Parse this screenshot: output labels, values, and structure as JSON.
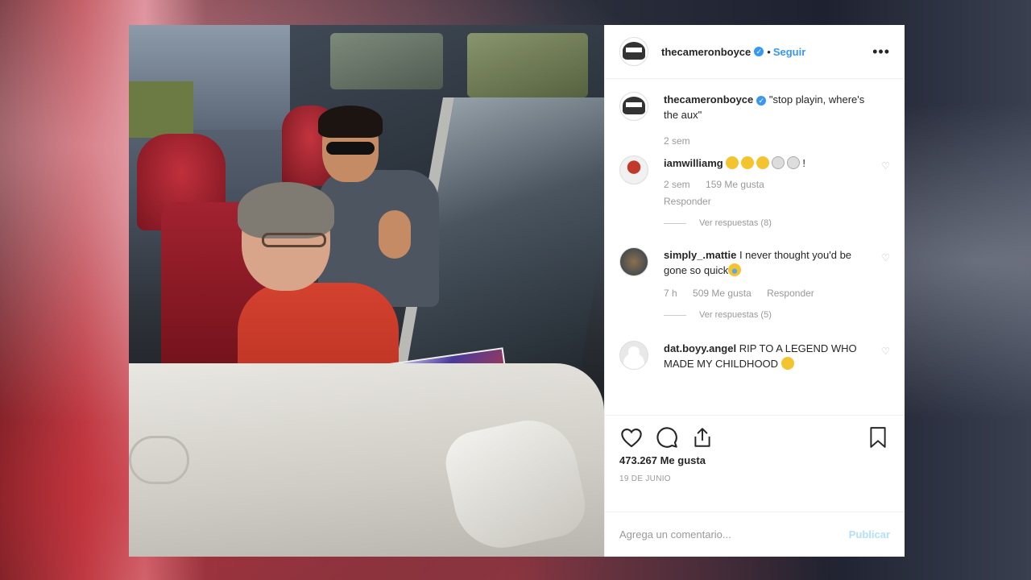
{
  "header": {
    "username": "thecameronboyce",
    "follow_label": "Seguir",
    "more_label": "•••"
  },
  "comments": [
    {
      "username": "thecameronboyce",
      "text": "\"stop playin, where's the aux\"",
      "time": "2 sem"
    },
    {
      "username": "iamwilliamg",
      "text": "!",
      "time": "2 sem",
      "likes": "159 Me gusta",
      "reply": "Responder",
      "view_replies": "Ver respuestas (8)"
    },
    {
      "username": "simply_.mattie",
      "text": "I never thought you'd be gone so quick",
      "time": "7 h",
      "likes": "509 Me gusta",
      "reply": "Responder",
      "view_replies": "Ver respuestas (5)"
    },
    {
      "username": "dat.boyy.angel",
      "text": "RIP TO A LEGEND WHO MADE MY CHILDHOOD"
    }
  ],
  "actions": {
    "likes": "473.267 Me gusta",
    "date": "19 DE JUNIO"
  },
  "add_comment": {
    "placeholder": "Agrega un comentario...",
    "publish_label": "Publicar"
  },
  "colors": {
    "accent": "#3897f0",
    "publish_disabled": "#b2dffc",
    "text": "#262626",
    "muted": "#999999"
  }
}
